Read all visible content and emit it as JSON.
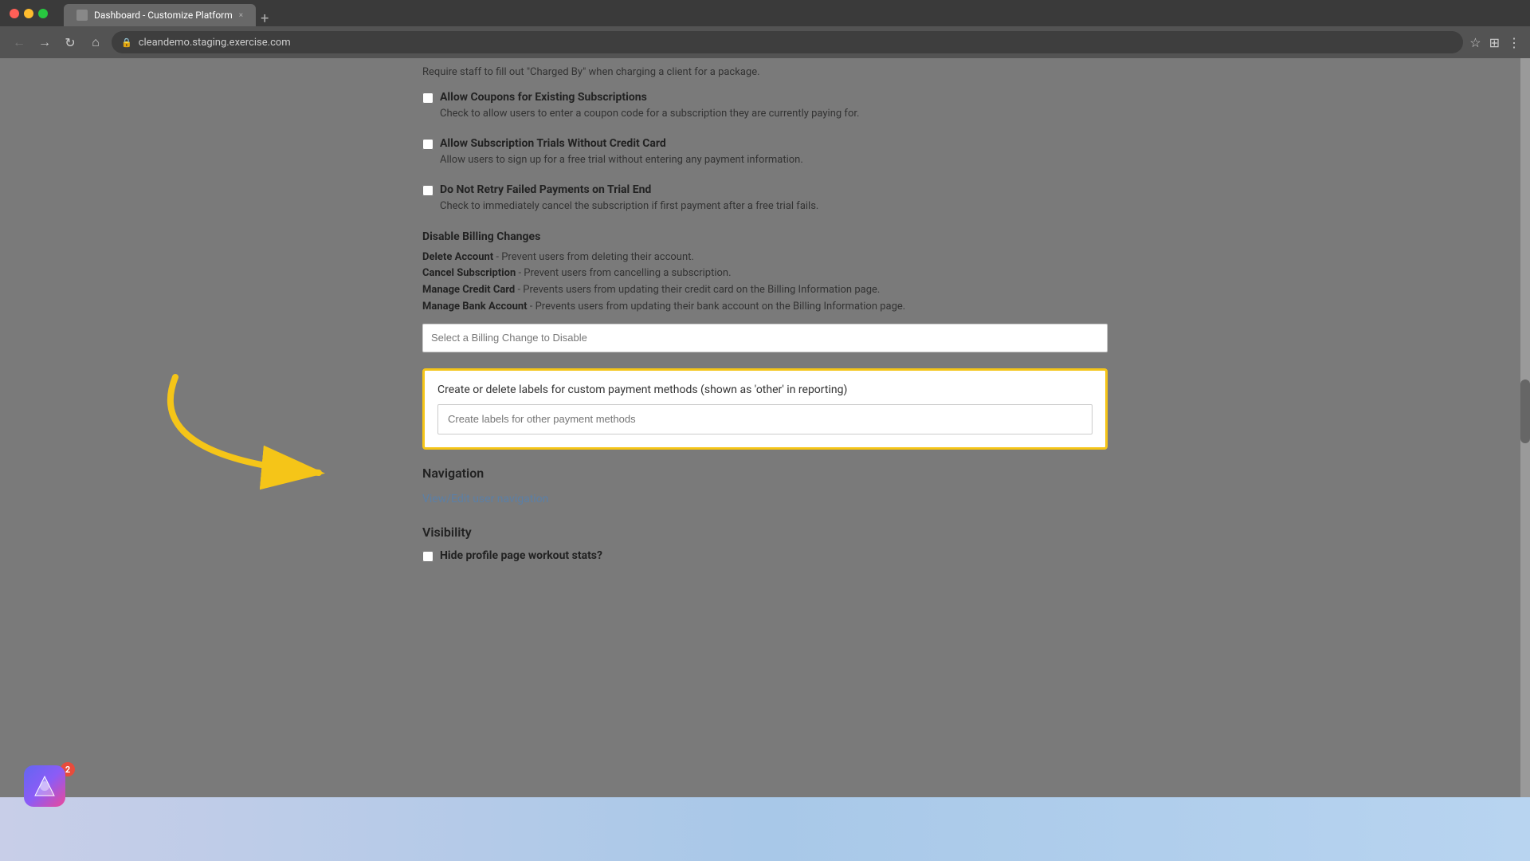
{
  "browser": {
    "title": "Dashboard - Customize Platform",
    "url": "cleandemo.staging.exercise.com",
    "tab_close": "×",
    "tab_new": "+"
  },
  "nav": {
    "back": "←",
    "forward": "→",
    "refresh": "↻",
    "home": "⌂",
    "star": "☆",
    "extensions": "⊞",
    "menu": "⋮"
  },
  "page": {
    "top_description": "Require staff to fill out \"Charged By\" when charging a client for a package.",
    "settings": [
      {
        "id": "allow-coupons",
        "label": "Allow Coupons for Existing Subscriptions",
        "description": "Check to allow users to enter a coupon code for a subscription they are currently paying for.",
        "checked": false
      },
      {
        "id": "allow-trials",
        "label": "Allow Subscription Trials Without Credit Card",
        "description": "Allow users to sign up for a free trial without entering any payment information.",
        "checked": false
      },
      {
        "id": "no-retry",
        "label": "Do Not Retry Failed Payments on Trial End",
        "description": "Check to immediately cancel the subscription if first payment after a free trial fails.",
        "checked": false
      }
    ],
    "disable_billing": {
      "title": "Disable Billing Changes",
      "lines": [
        {
          "strong": "Delete Account",
          "text": " - Prevent users from deleting their account."
        },
        {
          "strong": "Cancel Subscription",
          "text": " - Prevent users from cancelling a subscription."
        },
        {
          "strong": "Manage Credit Card",
          "text": " - Prevents users from updating their credit card on the Billing Information page."
        },
        {
          "strong": "Manage Bank Account",
          "text": " - Prevents users from updating their bank account on the Billing Information page."
        }
      ],
      "select_placeholder": "Select a Billing Change to Disable"
    },
    "custom_payment": {
      "label": "Create or delete labels for custom payment methods (shown as 'other' in reporting)",
      "input_placeholder": "Create labels for other payment methods"
    },
    "navigation": {
      "title": "Navigation",
      "link": "View/Edit user navigation"
    },
    "visibility": {
      "title": "Visibility",
      "item_label": "Hide profile page workout stats?"
    }
  },
  "app_badge": "2"
}
